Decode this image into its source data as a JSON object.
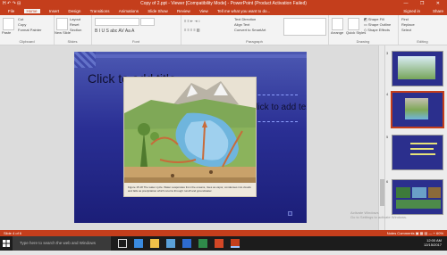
{
  "window": {
    "title": "Copy of 2.ppt - Viewer [Compatibility Mode] - PowerPoint (Product Activation Failed)",
    "quick_access": "H ↶ ↷ ⊟",
    "controls": "—  ❐  ✕"
  },
  "tabs": [
    "File",
    "Home",
    "Insert",
    "Design",
    "Transitions",
    "Animations",
    "Slide Show",
    "Review",
    "View",
    "Tell me what you want to do..."
  ],
  "active_tab": "Home",
  "account": {
    "user": "Signed in",
    "share": "Share"
  },
  "ribbon": {
    "groups": [
      {
        "label": "Clipboard",
        "items": [
          "Cut",
          "Copy",
          "Format Painter"
        ],
        "big": "Paste"
      },
      {
        "label": "Slides",
        "items": [
          "Layout",
          "Reset",
          "Section"
        ],
        "big": "New Slide"
      },
      {
        "label": "Font",
        "items": [
          "B  I  U  S  abc  AV  Aa  A"
        ]
      },
      {
        "label": "Paragraph",
        "items": [
          "Text Direction",
          "Align Text",
          "Convert to SmartArt"
        ]
      },
      {
        "label": "Drawing",
        "items": [
          "Arrange",
          "Quick Styles"
        ]
      },
      {
        "label": "Editing",
        "items": [
          "Find",
          "Replace",
          "Select"
        ]
      }
    ]
  },
  "slide": {
    "title": "Click to add title",
    "body": "Click to add text",
    "figure_caption": "Figure 15.18 The water cycle. Water evaporates from the oceans, rises as vapor, condenses into clouds and falls as precipitation which returns through runoff and groundwater."
  },
  "thumbnails": [
    {
      "num": "3"
    },
    {
      "num": "4"
    },
    {
      "num": "5"
    },
    {
      "num": "6"
    }
  ],
  "selected_thumbnail": "4",
  "status": {
    "left": "Slide 4 of 6",
    "right": "Notes   Comments   ▣  ▦  ▤   — + 60%"
  },
  "taskbar": {
    "search_placeholder": "Type here to search the web and Windows",
    "time": "12:00 AM",
    "date": "12/15/2017"
  },
  "watermark": {
    "line1": "Activate Windows",
    "line2": "Go to Settings to activate Windows."
  }
}
